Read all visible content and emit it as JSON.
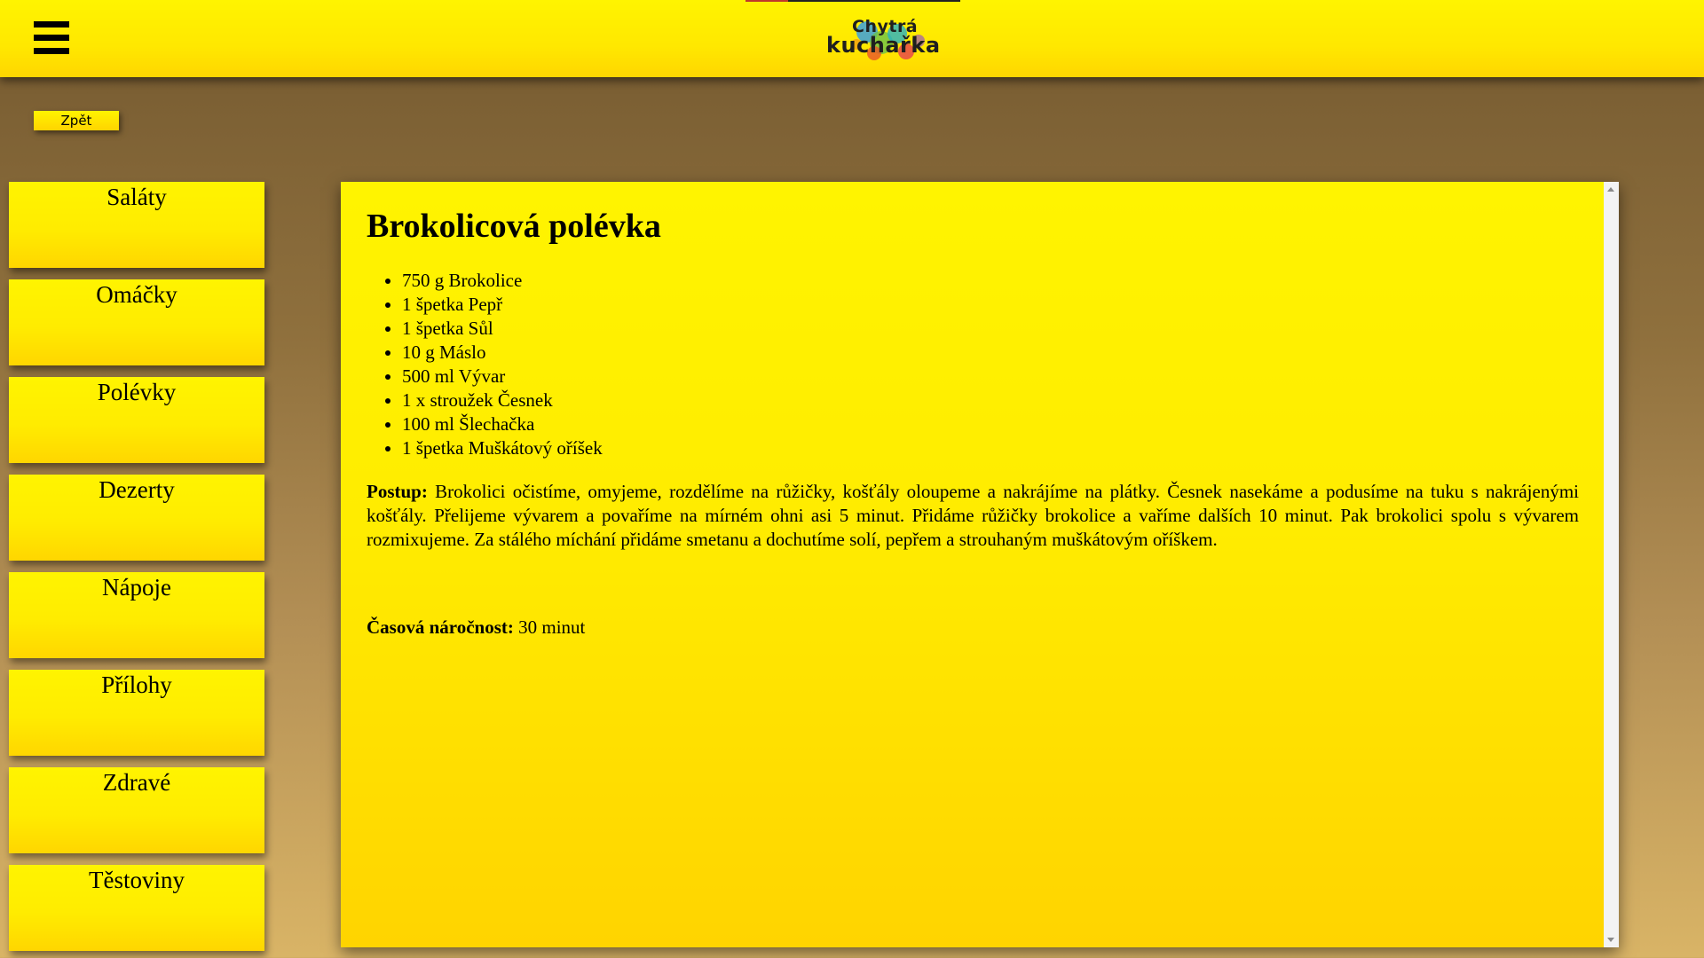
{
  "header": {
    "logo_line1": "Chytrá",
    "logo_line2": "kuchařka"
  },
  "back_button_label": "Zpět",
  "sidebar": {
    "categories": [
      {
        "label": "Saláty"
      },
      {
        "label": "Omáčky"
      },
      {
        "label": "Polévky"
      },
      {
        "label": "Dezerty"
      },
      {
        "label": "Nápoje"
      },
      {
        "label": "Přílohy"
      },
      {
        "label": "Zdravé"
      },
      {
        "label": "Těstoviny"
      }
    ]
  },
  "recipe": {
    "title": "Brokolicová polévka",
    "ingredients": [
      "750 g Brokolice",
      "1 špetka Pepř",
      "1 špetka Sůl",
      "10 g Máslo",
      "500 ml Vývar",
      "1 x stroužek Česnek",
      "100 ml Šlechačka",
      "1 špetka Muškátový oříšek"
    ],
    "procedure_label": "Postup:",
    "procedure_text": "Brokolici očistíme, omyjeme, rozdělíme na růžičky, košťály oloupeme a nakrájíme na plátky. Česnek nasekáme a podusíme na tuku s nakrájenými košťály. Přelijeme vývarem a povaříme na mírném ohni asi 5 minut. Přidáme růžičky brokolice a vaříme dalších 10 minut. Pak brokolici spolu s vývarem rozmixujeme. Za stálého míchání přidáme smetanu a dochutíme solí, pepřem a strouhaným muškátovým oříškem.",
    "time_label": "Časová náročnost:",
    "time_value": "30 minut"
  },
  "icons": {
    "menu": "hamburger-menu-icon",
    "scroll_up": "scroll-up-arrow-icon",
    "scroll_down": "scroll-down-arrow-icon"
  },
  "colors": {
    "header_yellow": "#fff400",
    "card_yellow_bottom": "#ffd600",
    "background_brown": "#7c6034"
  }
}
